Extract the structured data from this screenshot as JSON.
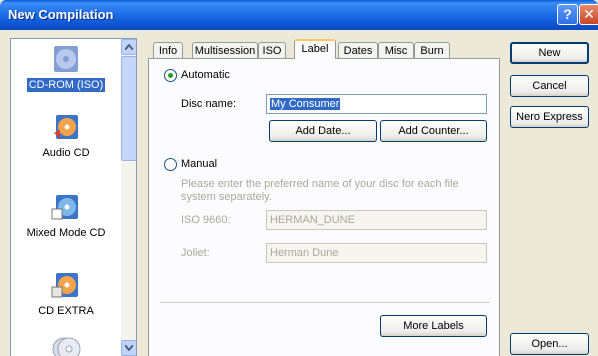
{
  "window": {
    "title": "New Compilation"
  },
  "categories": [
    {
      "label": "CD-ROM (ISO)",
      "icon": "cd-rom-icon",
      "selected": true
    },
    {
      "label": "Audio CD",
      "icon": "audio-cd-icon",
      "selected": false
    },
    {
      "label": "Mixed Mode CD",
      "icon": "mixed-mode-cd-icon",
      "selected": false
    },
    {
      "label": "CD EXTRA",
      "icon": "cd-extra-icon",
      "selected": false
    }
  ],
  "tabs": [
    {
      "label": "Info",
      "active": false
    },
    {
      "label": "Multisession",
      "active": false
    },
    {
      "label": "ISO",
      "active": false
    },
    {
      "label": "Label",
      "active": true
    },
    {
      "label": "Dates",
      "active": false
    },
    {
      "label": "Misc",
      "active": false
    },
    {
      "label": "Burn",
      "active": false
    }
  ],
  "label_tab": {
    "automatic_label": "Automatic",
    "disc_name_label": "Disc name:",
    "disc_name_value": "My Consumer",
    "add_date_button": "Add Date...",
    "add_counter_button": "Add Counter...",
    "manual_label": "Manual",
    "manual_description": "Please enter the preferred name of your disc for each file system separately.",
    "iso_label": "ISO 9660:",
    "iso_value": "HERMAN_DUNE",
    "joliet_label": "Joliet:",
    "joliet_value": "Herman Dune",
    "more_labels_button": "More Labels"
  },
  "side_buttons": {
    "new": "New",
    "cancel": "Cancel",
    "nero_express": "Nero Express",
    "open": "Open..."
  },
  "colors": {
    "titlebar": "#0a5bd8",
    "selection": "#316ac5",
    "tab_highlight": "#f7c66a"
  }
}
